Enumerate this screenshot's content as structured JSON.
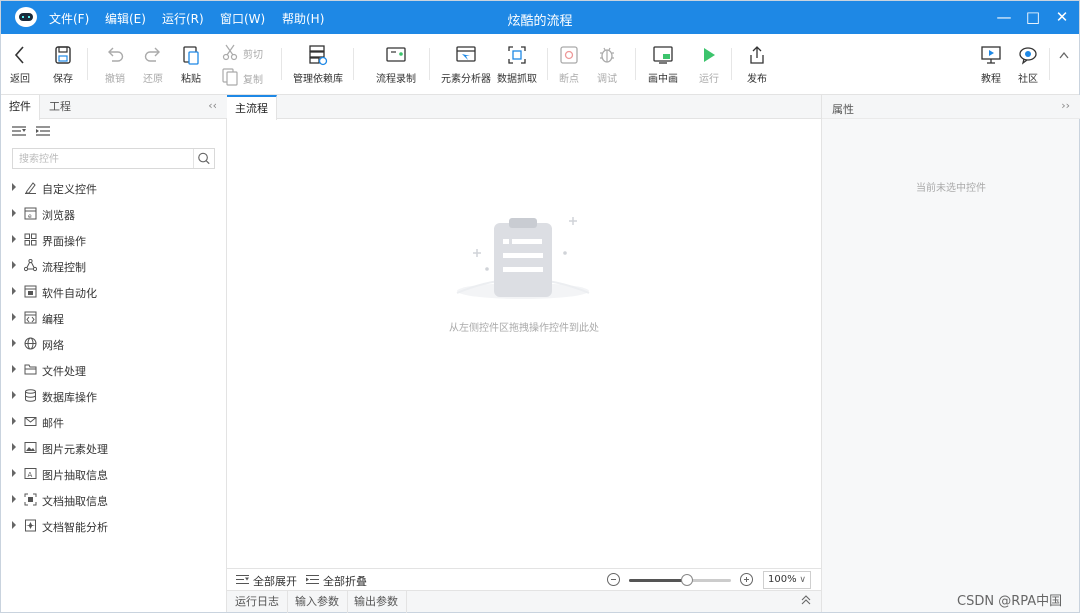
{
  "title_bar": {
    "title": "炫酷的流程",
    "menus": [
      "文件(F)",
      "编辑(E)",
      "运行(R)",
      "窗口(W)",
      "帮助(H)"
    ]
  },
  "toolbar": {
    "back": "返回",
    "save": "保存",
    "undo": "撤销",
    "redo": "还原",
    "paste": "粘贴",
    "cut": "剪切",
    "copy": "复制",
    "manage_deps": "管理依赖库",
    "record": "流程录制",
    "element_analyzer": "元素分析器",
    "data_capture": "数据抓取",
    "breakpoint": "断点",
    "debug": "调试",
    "pip": "画中画",
    "run": "运行",
    "publish": "发布",
    "tutorial": "教程",
    "community": "社区"
  },
  "left_panel": {
    "tabs": [
      "控件",
      "工程"
    ],
    "search_placeholder": "搜索控件",
    "categories": [
      {
        "label": "自定义控件",
        "icon": "pen-icon"
      },
      {
        "label": "浏览器",
        "icon": "browser-icon"
      },
      {
        "label": "界面操作",
        "icon": "ui-grid-icon"
      },
      {
        "label": "流程控制",
        "icon": "flow-icon"
      },
      {
        "label": "软件自动化",
        "icon": "software-icon"
      },
      {
        "label": "编程",
        "icon": "code-icon"
      },
      {
        "label": "网络",
        "icon": "globe-icon"
      },
      {
        "label": "文件处理",
        "icon": "folder-icon"
      },
      {
        "label": "数据库操作",
        "icon": "database-icon"
      },
      {
        "label": "邮件",
        "icon": "mail-icon"
      },
      {
        "label": "图片元素处理",
        "icon": "image-icon"
      },
      {
        "label": "图片抽取信息",
        "icon": "image-text-icon"
      },
      {
        "label": "文档抽取信息",
        "icon": "doc-scan-icon"
      },
      {
        "label": "文档智能分析",
        "icon": "doc-ai-icon"
      }
    ]
  },
  "center": {
    "tab": "主流程",
    "empty_hint": "从左侧控件区拖拽操作控件到此处",
    "expand_all": "全部展开",
    "collapse_all": "全部折叠",
    "zoom_level": 0.57,
    "zoom_label": "100%",
    "log_tabs": [
      "运行日志",
      "输入参数",
      "输出参数"
    ]
  },
  "right_panel": {
    "title": "属性",
    "empty_hint": "当前未选中控件"
  },
  "watermark": "CSDN @RPA中国",
  "colors": {
    "accent": "#1e88e5",
    "run_green": "#3cc46c"
  }
}
